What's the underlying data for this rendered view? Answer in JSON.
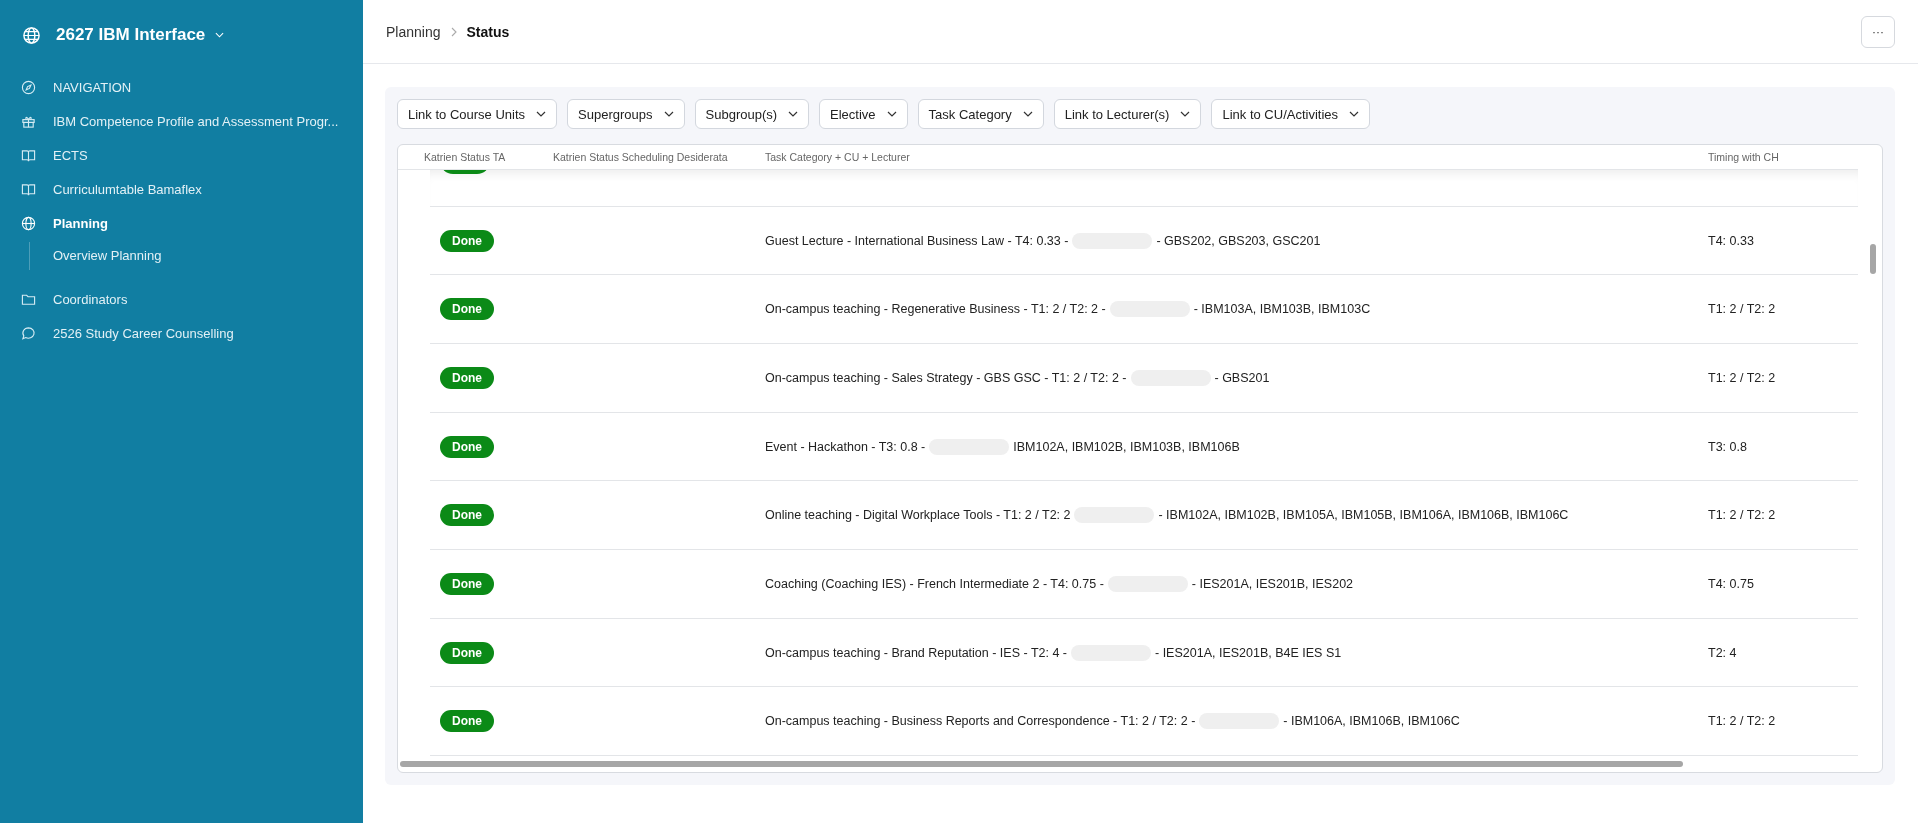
{
  "sidebar": {
    "title": "2627 IBM Interface",
    "items": [
      {
        "label": "NAVIGATION",
        "selected": false
      },
      {
        "label": "IBM Competence Profile and Assessment Progr...",
        "selected": false
      },
      {
        "label": "ECTS",
        "selected": false
      },
      {
        "label": "Curriculumtable Bamaflex",
        "selected": false
      },
      {
        "label": "Planning",
        "selected": true,
        "children": [
          {
            "label": "Overview Planning",
            "selected": false
          }
        ]
      },
      {
        "label": "Coordinators",
        "selected": false
      },
      {
        "label": "2526 Study Career Counselling",
        "selected": false
      }
    ]
  },
  "breadcrumb": [
    "Planning",
    "Status"
  ],
  "more_button": "···",
  "filters": [
    "Link to Course Units",
    "Supergroups",
    "Subgroup(s)",
    "Elective",
    "Task Category",
    "Link to Lecturer(s)",
    "Link to CU/Activities"
  ],
  "table": {
    "columns": [
      "Katrien Status TA",
      "Katrien Status Scheduling Desiderata",
      "Task Category + CU + Lecturer",
      "Timing with CH"
    ],
    "rows": [
      {
        "status": "Done",
        "task_before": "Guest Lecture - International Business Law - T4: 0.33 -",
        "task_after": "- GBS202, GBS203, GSC201",
        "timing": "T4: 0.33"
      },
      {
        "status": "Done",
        "task_before": "On-campus teaching - Regenerative Business - T1: 2 / T2: 2 -",
        "task_after": "- IBM103A, IBM103B, IBM103C",
        "timing": "T1: 2 / T2: 2"
      },
      {
        "status": "Done",
        "task_before": "On-campus teaching - Sales Strategy - GBS GSC - T1: 2 / T2: 2 -",
        "task_after": "- GBS201",
        "timing": "T1: 2 / T2: 2"
      },
      {
        "status": "Done",
        "task_before": "Event - Hackathon - T3: 0.8 -",
        "task_after": "IBM102A, IBM102B, IBM103B, IBM106B",
        "timing": "T3: 0.8"
      },
      {
        "status": "Done",
        "task_before": "Online teaching - Digital Workplace Tools - T1: 2 / T2: 2",
        "task_after": "- IBM102A, IBM102B, IBM105A, IBM105B, IBM106A, IBM106B, IBM106C",
        "timing": "T1: 2 / T2: 2"
      },
      {
        "status": "Done",
        "task_before": "Coaching (Coaching IES) - French Intermediate 2 - T4: 0.75 -",
        "task_after": "- IES201A, IES201B, IES202",
        "timing": "T4: 0.75"
      },
      {
        "status": "Done",
        "task_before": "On-campus teaching - Brand Reputation - IES - T2: 4 -",
        "task_after": "- IES201A, IES201B, B4E IES S1",
        "timing": "T2: 4"
      },
      {
        "status": "Done",
        "task_before": "On-campus teaching - Business Reports and Correspondence - T1: 2 / T2: 2 -",
        "task_after": "- IBM106A, IBM106B, IBM106C",
        "timing": "T1: 2 / T2: 2"
      }
    ]
  }
}
